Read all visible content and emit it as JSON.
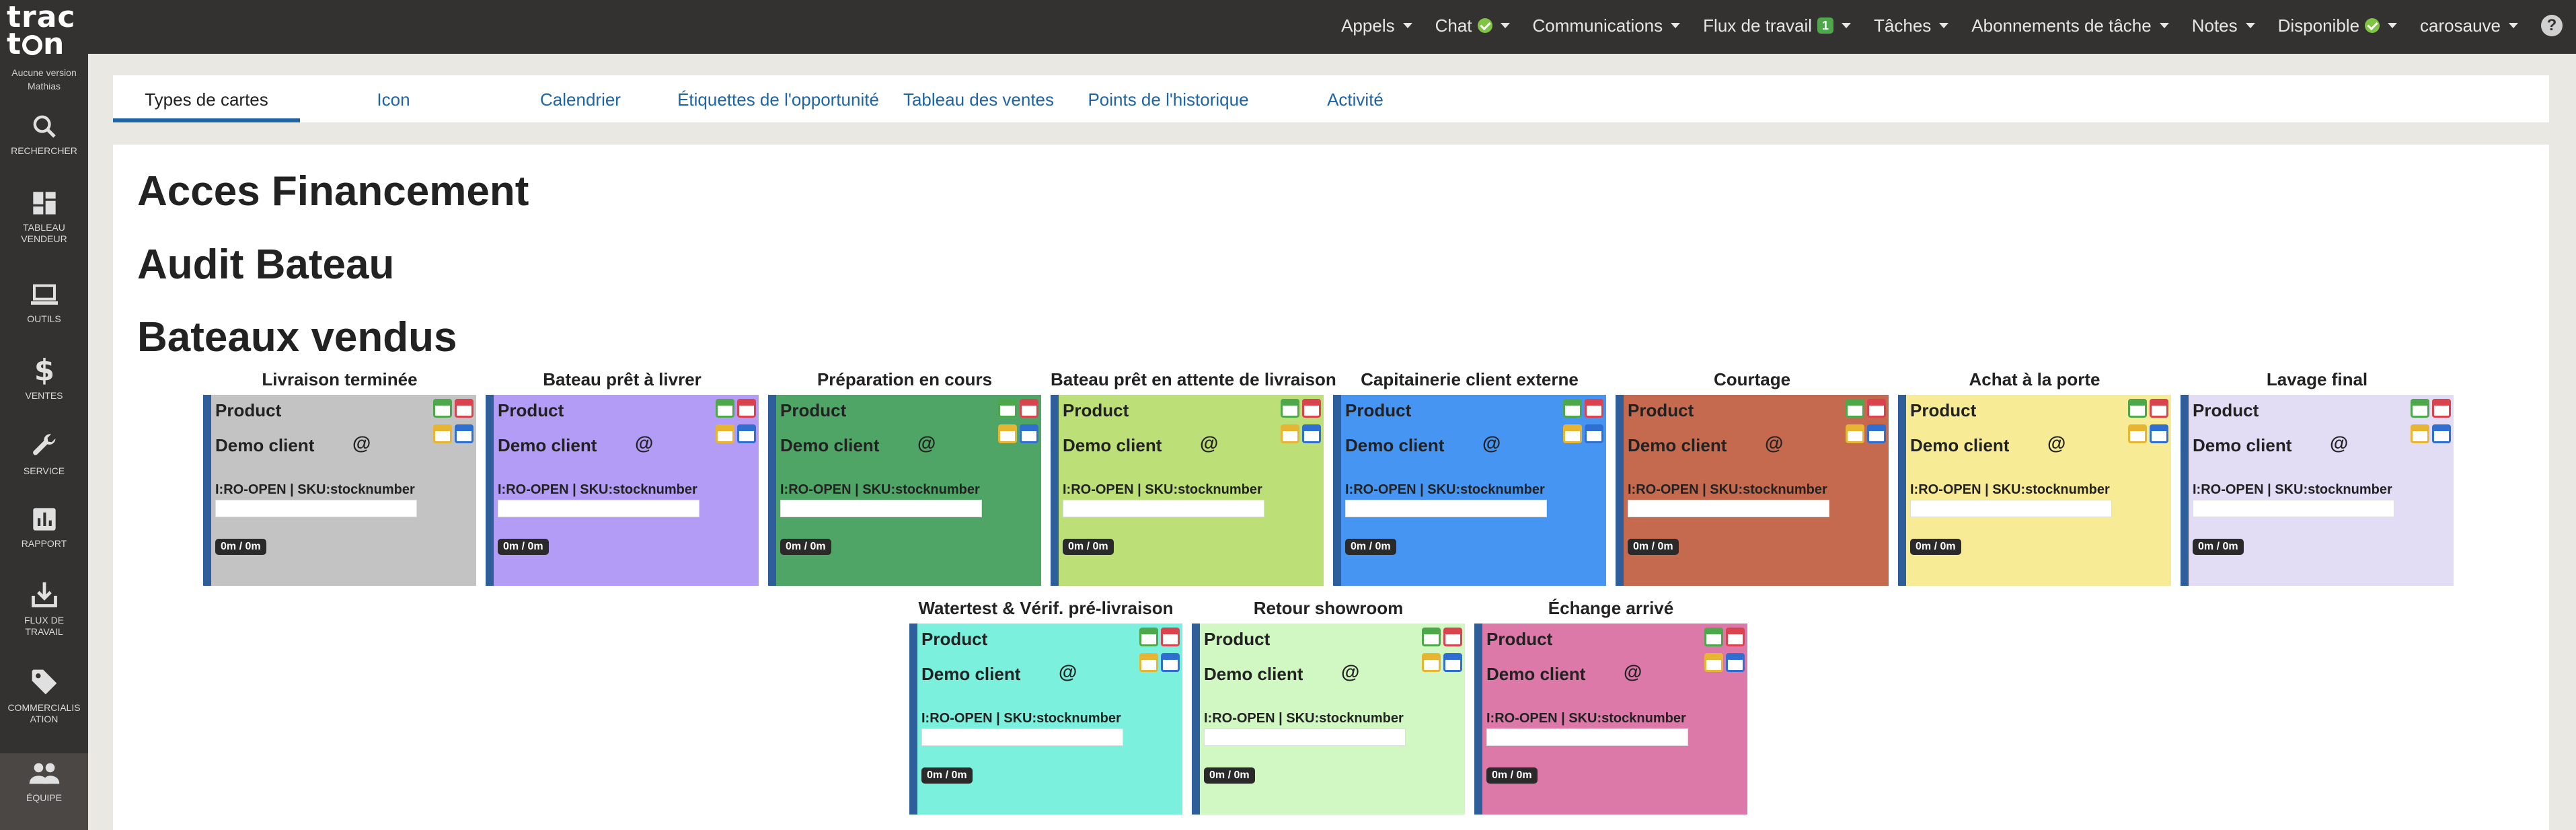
{
  "app": {
    "logo_line1": "trac",
    "logo_line2a": "t",
    "logo_line2b": "n",
    "version_line1": "Aucune version",
    "version_line2": "Mathias"
  },
  "sidebar": {
    "items": [
      {
        "label": "RECHERCHER",
        "icon": "search-icon"
      },
      {
        "label": "TABLEAU\nVENDEUR",
        "icon": "dashboard-icon"
      },
      {
        "label": "OUTILS",
        "icon": "laptop-icon"
      },
      {
        "label": "VENTES",
        "icon": "dollar-icon"
      },
      {
        "label": "SERVICE",
        "icon": "wrench-icon"
      },
      {
        "label": "RAPPORT",
        "icon": "report-icon"
      },
      {
        "label": "FLUX DE\nTRAVAIL",
        "icon": "download-icon"
      },
      {
        "label": "COMMERCIALIS\nATION",
        "icon": "tag-icon"
      },
      {
        "label": "ÉQUIPE",
        "icon": "team-icon"
      }
    ]
  },
  "topbar": {
    "items": [
      {
        "label": "Appels"
      },
      {
        "label": "Chat"
      },
      {
        "label": "Communications"
      },
      {
        "label": "Flux de travail",
        "badge": "1"
      },
      {
        "label": "Tâches"
      },
      {
        "label": "Abonnements de tâche"
      },
      {
        "label": "Notes"
      },
      {
        "label": "Disponible"
      },
      {
        "label": "carosauve"
      }
    ],
    "help": "?"
  },
  "tabs": [
    {
      "label": "Types de cartes",
      "active": true
    },
    {
      "label": "Icon"
    },
    {
      "label": "Calendrier"
    },
    {
      "label": "Étiquettes de l'opportunité"
    },
    {
      "label": "Tableau des ventes"
    },
    {
      "label": "Points de l'historique"
    },
    {
      "label": "Activité"
    }
  ],
  "sections": [
    {
      "title": "Acces Financement"
    },
    {
      "title": "Audit Bateau"
    },
    {
      "title": "Bateaux vendus"
    }
  ],
  "card_template": {
    "product": "Product",
    "client": "Demo client",
    "at": "@",
    "sku": "I:RO-OPEN | SKU:stocknumber",
    "time": "0m / 0m"
  },
  "cards": [
    {
      "title": "Livraison terminée",
      "color": "#c3c3c3"
    },
    {
      "title": "Bateau prêt à livrer",
      "color": "#b39cf5"
    },
    {
      "title": "Préparation en cours",
      "color": "#4fa565"
    },
    {
      "title": "Bateau prêt en attente de livraison",
      "color": "#bddf78"
    },
    {
      "title": "Capitainerie client externe",
      "color": "#4795f2"
    },
    {
      "title": "Courtage",
      "color": "#c66a4f"
    },
    {
      "title": "Achat à la porte",
      "color": "#f7ec95"
    },
    {
      "title": "Lavage final",
      "color": "#e2dcf5"
    },
    {
      "title": "Watertest & Vérif. pré-livraison",
      "color": "#7af0dd"
    },
    {
      "title": "Retour showroom",
      "color": "#d1f7c2"
    },
    {
      "title": "Échange arrivé",
      "color": "#dc79a8"
    }
  ]
}
